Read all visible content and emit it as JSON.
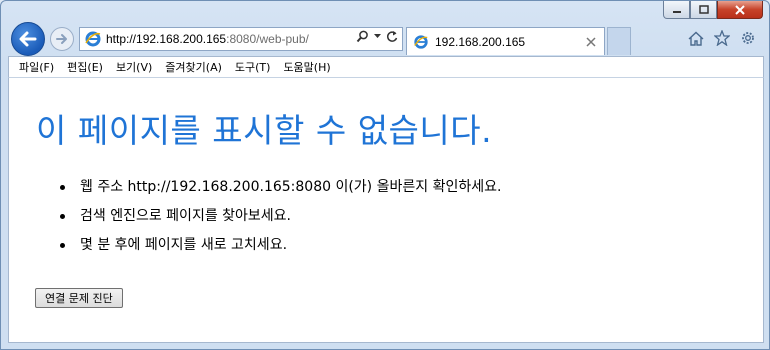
{
  "address_bar": {
    "url_host": "http://192.168.200.165",
    "url_rest": ":8080/web-pub/"
  },
  "tab": {
    "title": "192.168.200.165"
  },
  "menu": [
    "파일(F)",
    "편집(E)",
    "보기(V)",
    "즐겨찾기(A)",
    "도구(T)",
    "도움말(H)"
  ],
  "error_page": {
    "heading": "이 페이지를 표시할 수 없습니다.",
    "tips": [
      "웹 주소 http://192.168.200.165:8080 이(가) 올바른지 확인하세요.",
      "검색 엔진으로 페이지를 찾아보세요.",
      "몇 분 후에 페이지를 새로 고치세요."
    ],
    "diagnose_button": "연결 문제 진단"
  },
  "colors": {
    "heading": "#1f74d6",
    "back_button": "#1a5bb8",
    "close_button": "#c7432a"
  },
  "icons": {
    "back": "back-arrow-icon",
    "forward": "forward-arrow-icon",
    "site": "ie-page-icon",
    "search": "search-icon",
    "refresh": "refresh-icon",
    "home": "home-icon",
    "favorites": "star-icon",
    "settings": "gear-icon"
  }
}
